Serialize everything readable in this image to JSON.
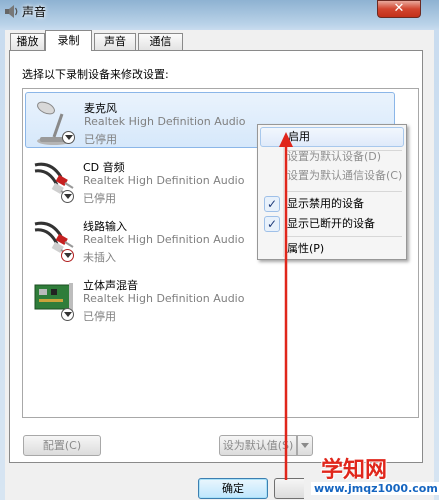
{
  "window": {
    "title": "声音",
    "close_glyph": "✕"
  },
  "tabs": [
    {
      "label": "播放"
    },
    {
      "label": "录制",
      "active": true
    },
    {
      "label": "声音"
    },
    {
      "label": "通信"
    }
  ],
  "instruction": "选择以下录制设备来修改设置:",
  "devices": [
    {
      "name": "麦克风",
      "driver": "Realtek High Definition Audio",
      "status": "已停用",
      "icon": "microphone-icon",
      "selected": true
    },
    {
      "name": "CD 音频",
      "driver": "Realtek High Definition Audio",
      "status": "已停用",
      "icon": "audio-cable-icon"
    },
    {
      "name": "线路输入",
      "driver": "Realtek High Definition Audio",
      "status": "未插入",
      "icon": "audio-cable-icon"
    },
    {
      "name": "立体声混音",
      "driver": "Realtek High Definition Audio",
      "status": "已停用",
      "icon": "sound-card-icon"
    }
  ],
  "context_menu": {
    "enable": "启用",
    "set_default": "设置为默认设备(D)",
    "set_default_comm": "设置为默认通信设备(C)",
    "show_disabled": "显示禁用的设备",
    "show_disconnected": "显示已断开的设备",
    "properties": "属性(P)",
    "check_glyph": "✓"
  },
  "buttons": {
    "configure": "配置(C)",
    "set_default": "设为默认值(S)",
    "ok": "确定"
  },
  "watermark": {
    "main": "学知网",
    "url": "www.jmqz1000.com"
  },
  "colors": {
    "annotation_arrow": "#e0261b",
    "selection": "#d6e8fb"
  }
}
